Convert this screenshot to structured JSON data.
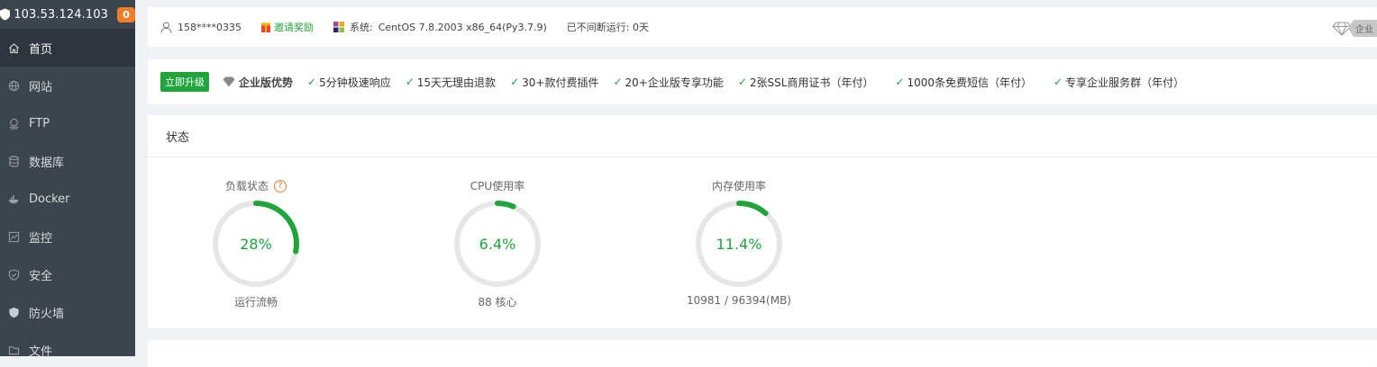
{
  "sidebar": {
    "server_ip": "103.53.124.103",
    "badge_count": "0",
    "items": [
      {
        "label": "首页",
        "icon": "home-icon",
        "active": true
      },
      {
        "label": "网站",
        "icon": "globe-icon"
      },
      {
        "label": "FTP",
        "icon": "ftp-icon"
      },
      {
        "label": "数据库",
        "icon": "database-icon"
      },
      {
        "label": "Docker",
        "icon": "docker-icon"
      },
      {
        "label": "监控",
        "icon": "monitor-icon"
      },
      {
        "label": "安全",
        "icon": "shield-check-icon"
      },
      {
        "label": "防火墙",
        "icon": "firewall-shield-icon"
      },
      {
        "label": "文件",
        "icon": "folder-icon"
      }
    ]
  },
  "topbar": {
    "user": "158****0335",
    "invite_label": "邀请奖励",
    "system_label": "系统:",
    "system_value": "CentOS 7.8.2003 x86_64(Py3.7.9)",
    "uptime": "已不间断运行: 0天",
    "enterprise_label": "企业"
  },
  "promo": {
    "upgrade_label": "立即升级",
    "enterprise_adv": "企业版优势",
    "features": [
      "5分钟极速响应",
      "15天无理由退款",
      "30+款付费插件",
      "20+企业版专享功能",
      "2张SSL商用证书（年付）",
      "1000条免费短信（年付）",
      "专享企业服务群（年付）"
    ]
  },
  "status": {
    "title": "状态",
    "gauges": [
      {
        "title": "负载状态",
        "value": "28%",
        "percent": 28,
        "subtitle": "运行流畅",
        "help": "?"
      },
      {
        "title": "CPU使用率",
        "value": "6.4%",
        "percent": 6.4,
        "subtitle": "88 核心"
      },
      {
        "title": "内存使用率",
        "value": "11.4%",
        "percent": 11.4,
        "subtitle": "10981 / 96394(MB)"
      }
    ]
  },
  "colors": {
    "accent_green": "#20a53a",
    "sidebar_bg": "#3c444d",
    "badge_orange": "#ef7d2a",
    "track_gray": "#e6e6e6"
  }
}
